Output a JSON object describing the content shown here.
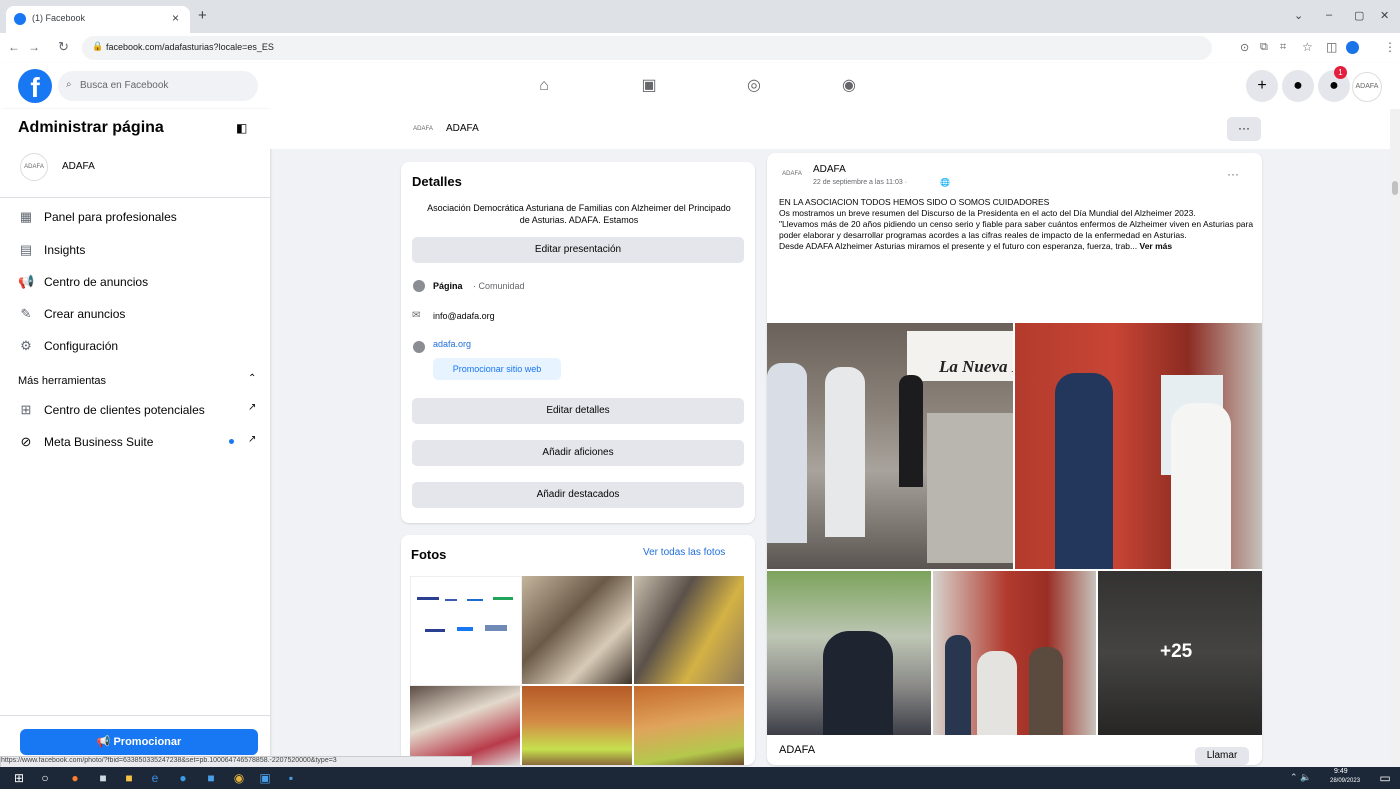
{
  "browser": {
    "tab_title": "(1) Facebook",
    "tab_close": "×",
    "new_tab": "+",
    "url": "facebook.com/adafasturias?locale=es_ES",
    "window_controls": [
      "⌄",
      "–",
      "▢",
      "✕"
    ]
  },
  "header": {
    "logo": "f",
    "search_placeholder": "Busca en Facebook",
    "nav_icons": [
      "home-icon",
      "video-icon",
      "groups-icon",
      "gaming-icon"
    ],
    "notification_badge": "1"
  },
  "sidebar": {
    "title": "Administrar página",
    "page_name": "ADAFA",
    "items": [
      {
        "label": "Panel para profesionales",
        "icon": "dashboard-icon"
      },
      {
        "label": "Insights",
        "icon": "insights-icon"
      },
      {
        "label": "Centro de anuncios",
        "icon": "megaphone-icon"
      },
      {
        "label": "Crear anuncios",
        "icon": "edit-icon"
      },
      {
        "label": "Configuración",
        "icon": "gear-icon"
      }
    ],
    "more_tools": "Más herramientas",
    "tools": [
      {
        "label": "Centro de clientes potenciales",
        "icon": "leads-icon"
      },
      {
        "label": "Meta Business Suite",
        "icon": "meta-icon"
      }
    ],
    "promote": "Promocionar"
  },
  "page_header": {
    "name": "ADAFA",
    "more": "···"
  },
  "details": {
    "title": "Detalles",
    "description": "Asociación Democrática Asturiana de Familias con Alzheimer del Principado de Asturias. ADAFA. Estamos",
    "edit_presentation": "Editar presentación",
    "page_label": "Página",
    "page_category": "· Comunidad",
    "email": "info@adafa.org",
    "website": "adafa.org",
    "promote_site": "Promocionar sitio web",
    "edit_details": "Editar detalles",
    "add_hobbies": "Añadir aficiones",
    "add_featured": "Añadir destacados"
  },
  "photos": {
    "title": "Fotos",
    "see_all": "Ver todas las fotos"
  },
  "post": {
    "author": "ADAFA",
    "timestamp": "22 de septiembre a las 11:03 ·",
    "more": "···",
    "text": [
      "EN LA ASOCIACION TODOS HEMOS SIDO O SOMOS CUIDADORES",
      "Os mostramos un breve resumen del Discurso de la Presidenta en el acto del Día Mundial del Alzheimer 2023.",
      "\"Llevamos más de 20 años pidiendo un censo serio y fiable para saber cuántos enfermos de Alzheimer viven en Asturias para poder elaborar y desarrollar programas acordes a las cifras reales de impacto de la enfermedad en Asturias.",
      "Desde ADAFA Alzheimer Asturias miramos el presente y el futuro con esperanza, fuerza, trab..."
    ],
    "see_more": "Ver más",
    "sign_text": "La Nueva Es",
    "more_photos": "+25",
    "footer_name": "ADAFA",
    "call_button": "Llamar"
  },
  "status_url": "https://www.facebook.com/photo/?fbid=633850335247238&set=pb.100064746578858.-2207520000&type=3",
  "taskbar": {
    "time": "9:49",
    "date": "28/09/2023"
  },
  "colors": {
    "fb_blue": "#1877f2",
    "background": "#f0f2f5",
    "button_gray": "#e4e6eb"
  }
}
